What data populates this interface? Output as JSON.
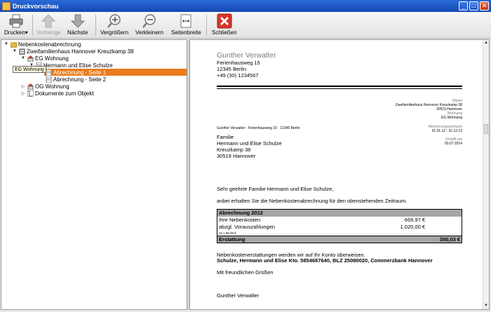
{
  "window": {
    "title": "Druckvorschau",
    "min": "_",
    "max": "□",
    "close": "✕"
  },
  "toolbar": {
    "print": "Drucken",
    "prev": "Vorherige",
    "next": "Nächste",
    "zoom_in": "Vergrößern",
    "zoom_out": "Verkleinern",
    "page_width": "Seitenbreite",
    "close": "Schließen"
  },
  "tree": {
    "root": "Nebenkostenabrechnung",
    "house": "Zweifamilienhaus Hannover Kreuzkamp 38",
    "eg": "EG Wohnung",
    "tenant": "Hermann und Elise Schulze",
    "page1": "Abrechnung - Seite 1",
    "page2": "Abrechnung - Seite 2",
    "og": "OG Wohnung",
    "docs": "Dokumente zum Objekt",
    "tooltip": "EG Wohnung"
  },
  "doc": {
    "sender_name": "Gunther Verwalter",
    "sender_street": "Ferienhausweg 15",
    "sender_city": "12345 Berlin",
    "sender_phone": "+49 (30) 1234567",
    "obj_label": "Objekt",
    "obj_line1": "Zweifamilienhaus Hannover Kreuzkamp 38",
    "obj_line2": "30519 Hannover",
    "flat_label": "Wohnung",
    "flat_value": "EG Wohnung",
    "sender_line": "Gunther Verwalter · Ferienhausweg 15 · 12345 Berlin",
    "period_label": "Abrechnungszeitraum",
    "period_value": "01.01.12 - 31.12.12",
    "created_label": "Erstellt am",
    "created_value": "03.07.2014",
    "rec_line1": "Familie",
    "rec_line2": "Hermann und Elise Schulze",
    "rec_line3": "Kreuzkamp 38",
    "rec_line4": "30519 Hannover",
    "salutation": "Sehr geehrte Familie Hermann und Elise Schulze,",
    "intro": "anbei erhalten Sie die Nebenkostenabrechnung für den obenstehenden Zeitraum.",
    "summary": {
      "title": "Abrechnung 2012",
      "row1_label": "Ihre Nebenkosten",
      "row1_value": "669,97 €",
      "row2_label": "abzgl. Vorauszahlungen",
      "row2_value": "1.020,00 €",
      "row2_sub": "12 x 85,00 €",
      "total_label": "Erstattung",
      "total_value": "350,03 €"
    },
    "refund_note": "Nebenkostenerstattungen werden wir auf Ihr Konto überweisen.",
    "bank_line": "Schulze, Hermann und Elise Kto. 5854687640, BLZ 25080020, Commerzbank Hannover",
    "closing": "Mit freundlichen Grüßen",
    "signature": "Gunther Verwalter"
  }
}
